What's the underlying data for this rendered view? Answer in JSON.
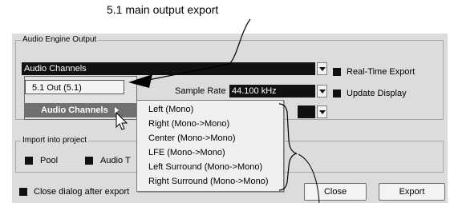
{
  "annotation": {
    "title": "5.1 main output export"
  },
  "dialog": {
    "engine_output_group": "Audio Engine Output",
    "output_dropdown": {
      "value": "Audio Channels"
    },
    "realtime_export": {
      "label": "Real-Time Export",
      "checked": true
    },
    "update_display": {
      "label": "Update Display",
      "checked": true
    },
    "sample_rate": {
      "label": "Sample Rate",
      "value": "44.100 kHz"
    },
    "import_group": "Import into project",
    "pool": {
      "label": "Pool",
      "checked": true
    },
    "audio_track": {
      "label": "Audio T",
      "checked": true
    },
    "close_after_export": {
      "label": "Close dialog after export",
      "checked": true
    },
    "buttons": {
      "close": "Close",
      "export": "Export"
    }
  },
  "popup_menu": {
    "items": [
      {
        "label": "5.1 Out (5.1)"
      },
      {
        "label": "Audio Channels",
        "has_submenu": true,
        "active": true
      }
    ]
  },
  "submenu": {
    "items": [
      {
        "label": "Left (Mono)"
      },
      {
        "label": "Right (Mono->Mono)"
      },
      {
        "label": "Center (Mono->Mono)"
      },
      {
        "label": "LFE (Mono->Mono)"
      },
      {
        "label": "Left Surround (Mono->Mono)"
      },
      {
        "label": "Right Surround (Mono->Mono)"
      }
    ]
  },
  "icons": [
    "mouse-cursor-icon",
    "dropdown-arrow-icon",
    "submenu-arrow-icon",
    "callout-arrow-icon"
  ]
}
